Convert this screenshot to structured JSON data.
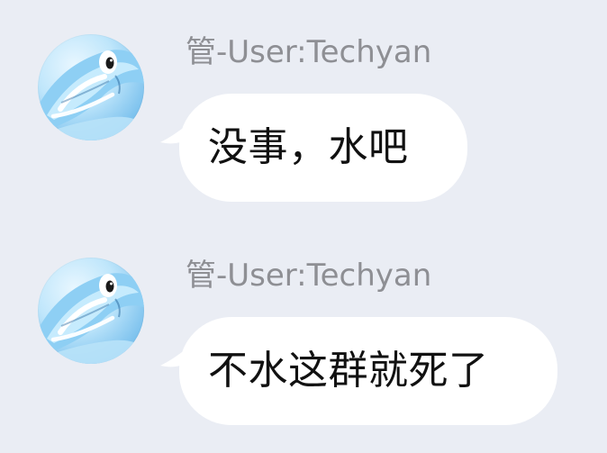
{
  "messages": [
    {
      "sender": "管-User:Techyan",
      "avatar_icon": "dolphin-avatar-icon",
      "text": "没事，水吧"
    },
    {
      "sender": "管-User:Techyan",
      "avatar_icon": "dolphin-avatar-icon",
      "text": "不水这群就死了"
    }
  ],
  "colors": {
    "background": "#eaedf4",
    "bubble": "#ffffff",
    "sender_text": "#8e8f94",
    "message_text": "#111111"
  }
}
